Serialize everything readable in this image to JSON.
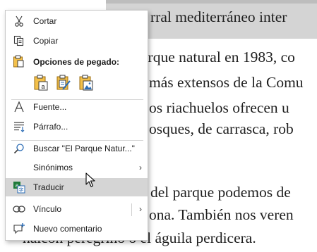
{
  "document": {
    "lines": [
      "rral mediterráneo inter",
      "arque natural en 1983, co",
      "más extensos de la Comu",
      "os riachuelos ofrecen u",
      "osques, de carrasca, rob",
      "del parque podemos de",
      "ona. También nos veren",
      "halcón peregrino o el águila perdicera."
    ]
  },
  "menu": {
    "cut": {
      "label": "Cortar",
      "icon": "scissors-icon"
    },
    "copy": {
      "label": "Copiar",
      "icon": "copy-icon"
    },
    "paste_options": {
      "title": "Opciones de pegado:",
      "buttons": [
        "paste-keep-text-only-icon",
        "paste-merge-formatting-icon",
        "paste-picture-icon"
      ]
    },
    "font": {
      "label": "Fuente...",
      "icon": "font-icon"
    },
    "paragraph": {
      "label": "Párrafo...",
      "icon": "paragraph-icon"
    },
    "search": {
      "label": "Buscar \"El Parque Natur...\"",
      "icon": "search-icon"
    },
    "synonyms": {
      "label": "Sinónimos",
      "arrow": "›"
    },
    "translate": {
      "label": "Traducir",
      "icon": "translate-icon",
      "highlighted": true
    },
    "link": {
      "label": "Vínculo",
      "icon": "link-icon",
      "arrow": "›"
    },
    "new_comment": {
      "label": "Nuevo comentario",
      "icon": "new-comment-icon"
    }
  },
  "colors": {
    "accent": "#2b6cb5",
    "highlight": "#d5d5d5",
    "icon_gray": "#3c3c3c"
  }
}
